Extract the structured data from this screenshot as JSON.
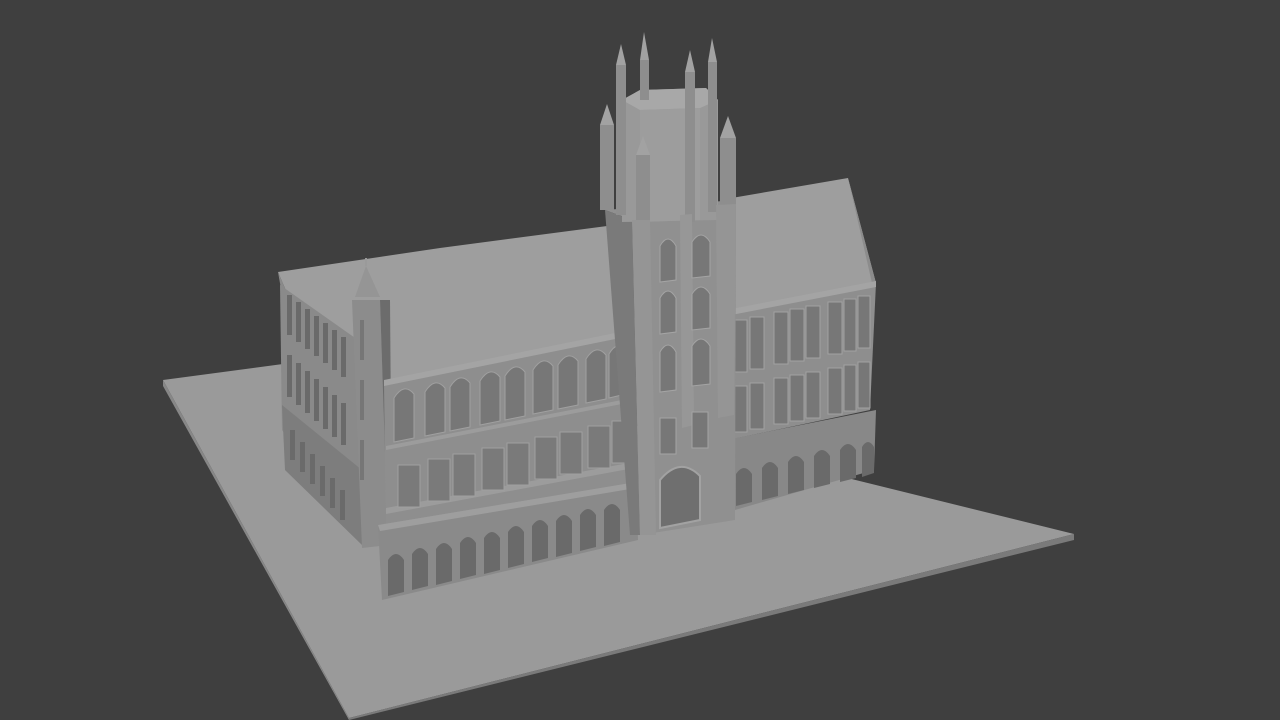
{
  "viewport": {
    "background": "#3f3f3f",
    "shading": "solid",
    "model": "gothic-town-hall"
  },
  "colors": {
    "ground_top": "#9a9a9a",
    "ground_side": "#777777",
    "roof": "#9d9d9d",
    "wall_light": "#8f8f8f",
    "wall_mid": "#858585",
    "wall_dark": "#6e6e6e",
    "wall_shadow": "#555555"
  }
}
